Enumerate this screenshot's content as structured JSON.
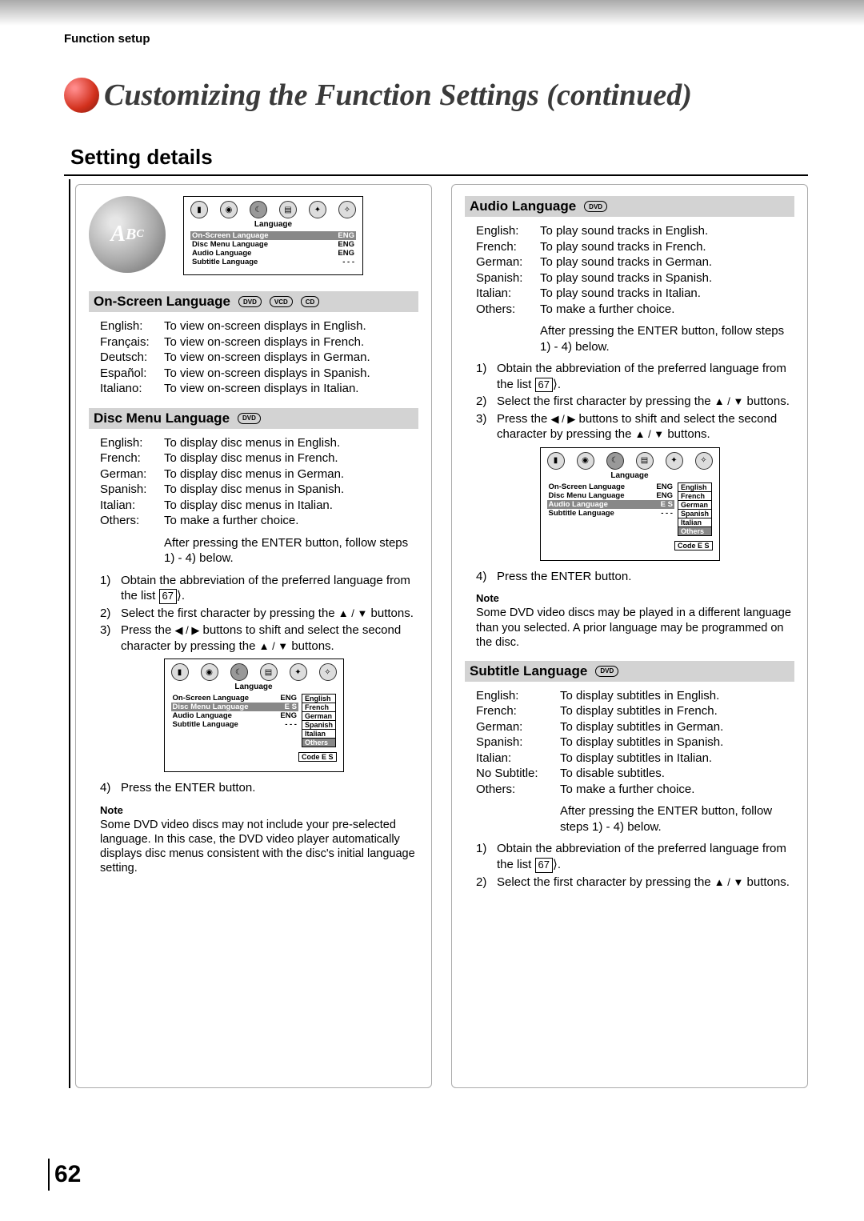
{
  "breadcrumb": "Function setup",
  "pageTitle": "Customizing the Function Settings (continued)",
  "sectionTitle": "Setting details",
  "pageNumber": "62",
  "pills": {
    "dvd": "DVD",
    "vcd": "VCD",
    "cd": "CD"
  },
  "boxed67": "67",
  "partialChevron": "⟩",
  "miniMain": {
    "label": "Language",
    "rows": [
      {
        "k": "On-Screen Language",
        "v": "ENG",
        "hi": true
      },
      {
        "k": "Disc Menu Language",
        "v": "ENG",
        "hi": false
      },
      {
        "k": "Audio Language",
        "v": "ENG",
        "hi": false
      },
      {
        "k": "Subtitle Language",
        "v": "- - -",
        "hi": false
      }
    ]
  },
  "miniDisc": {
    "label": "Language",
    "rows": [
      {
        "k": "On-Screen Language",
        "v": "ENG",
        "hi": false
      },
      {
        "k": "Disc Menu Language",
        "v": "E S",
        "hi": true
      },
      {
        "k": "Audio Language",
        "v": "ENG",
        "hi": false
      },
      {
        "k": "Subtitle Language",
        "v": "- - -",
        "hi": false
      }
    ],
    "sub": [
      "English",
      "French",
      "German",
      "Spanish",
      "Italian",
      "Others"
    ],
    "subHi": 5,
    "code": "Code  E  S"
  },
  "miniAudio": {
    "label": "Language",
    "rows": [
      {
        "k": "On-Screen Language",
        "v": "ENG",
        "hi": false
      },
      {
        "k": "Disc Menu Language",
        "v": "ENG",
        "hi": false
      },
      {
        "k": "Audio Language",
        "v": "E S",
        "hi": true
      },
      {
        "k": "Subtitle Language",
        "v": "- - -",
        "hi": false
      }
    ],
    "sub": [
      "English",
      "French",
      "German",
      "Spanish",
      "Italian",
      "Others"
    ],
    "subHi": 5,
    "code": "Code  E  S"
  },
  "onScreen": {
    "heading": "On-Screen Language",
    "items": [
      {
        "k": "English:",
        "v": "To view on-screen displays in English."
      },
      {
        "k": "Français:",
        "v": "To view on-screen displays in French."
      },
      {
        "k": "Deutsch:",
        "v": "To view on-screen displays in German."
      },
      {
        "k": "Español:",
        "v": "To view on-screen displays in Spanish."
      },
      {
        "k": "Italiano:",
        "v": "To view on-screen displays in Italian."
      }
    ]
  },
  "discMenu": {
    "heading": "Disc Menu Language",
    "items": [
      {
        "k": "English:",
        "v": "To display disc menus in English."
      },
      {
        "k": "French:",
        "v": "To display disc menus in French."
      },
      {
        "k": "German:",
        "v": "To display disc menus in German."
      },
      {
        "k": "Spanish:",
        "v": "To display disc menus in Spanish."
      },
      {
        "k": "Italian:",
        "v": "To display disc menus in Italian."
      },
      {
        "k": "Others:",
        "v": "To make a further choice."
      }
    ],
    "afterEnter": "After pressing the ENTER button, follow steps 1) - 4) below.",
    "steps": {
      "s1a": "Obtain the abbreviation of the preferred language from the list ",
      "s1b": ".",
      "s2a": "Select the first character by pressing the ",
      "s2b": " buttons.",
      "s3a": "Press the ",
      "s3b": " buttons to shift and select the second character by pressing the ",
      "s3c": " buttons.",
      "s4": "Press the ENTER button."
    },
    "noteH": "Note",
    "note": "Some DVD video discs may not include your pre-selected language. In this case, the DVD video player automatically displays disc menus consistent with the disc's initial language setting."
  },
  "audioLang": {
    "heading": "Audio Language",
    "items": [
      {
        "k": "English:",
        "v": "To play sound tracks in English."
      },
      {
        "k": "French:",
        "v": "To play sound tracks in French."
      },
      {
        "k": "German:",
        "v": "To play sound tracks in German."
      },
      {
        "k": "Spanish:",
        "v": "To play sound tracks in Spanish."
      },
      {
        "k": "Italian:",
        "v": "To play sound tracks in Italian."
      },
      {
        "k": "Others:",
        "v": "To make a further choice."
      }
    ],
    "afterEnter": "After pressing the ENTER button, follow steps 1) - 4) below.",
    "steps": {
      "s1a": "Obtain the abbreviation of the preferred language from the list ",
      "s1b": ".",
      "s2a": "Select the first character by pressing the ",
      "s2b": " buttons.",
      "s3a": "Press the ",
      "s3b": " buttons to shift and select the second character by pressing the ",
      "s3c": " buttons.",
      "s4": "Press the ENTER button."
    },
    "noteH": "Note",
    "note": "Some DVD video discs may be played in a different language than you selected. A prior language may be programmed on the disc."
  },
  "subtitle": {
    "heading": "Subtitle Language",
    "items": [
      {
        "k": "English:",
        "v": "To display subtitles in English."
      },
      {
        "k": "French:",
        "v": "To display subtitles in French."
      },
      {
        "k": "German:",
        "v": "To display subtitles in German."
      },
      {
        "k": "Spanish:",
        "v": "To display subtitles in Spanish."
      },
      {
        "k": "Italian:",
        "v": "To display subtitles in Italian."
      },
      {
        "k": "No Subtitle:",
        "v": "To disable subtitles."
      },
      {
        "k": "Others:",
        "v": "To make a further choice."
      }
    ],
    "afterEnter": "After pressing the ENTER button, follow steps 1) - 4) below.",
    "steps": {
      "s1a": "Obtain the abbreviation of the preferred language from the list ",
      "s1b": ".",
      "s2a": "Select the first character by pressing the ",
      "s2b": " buttons."
    }
  },
  "triUpDown": "▲ / ▼",
  "triLeftRight": "◀ / ▶"
}
